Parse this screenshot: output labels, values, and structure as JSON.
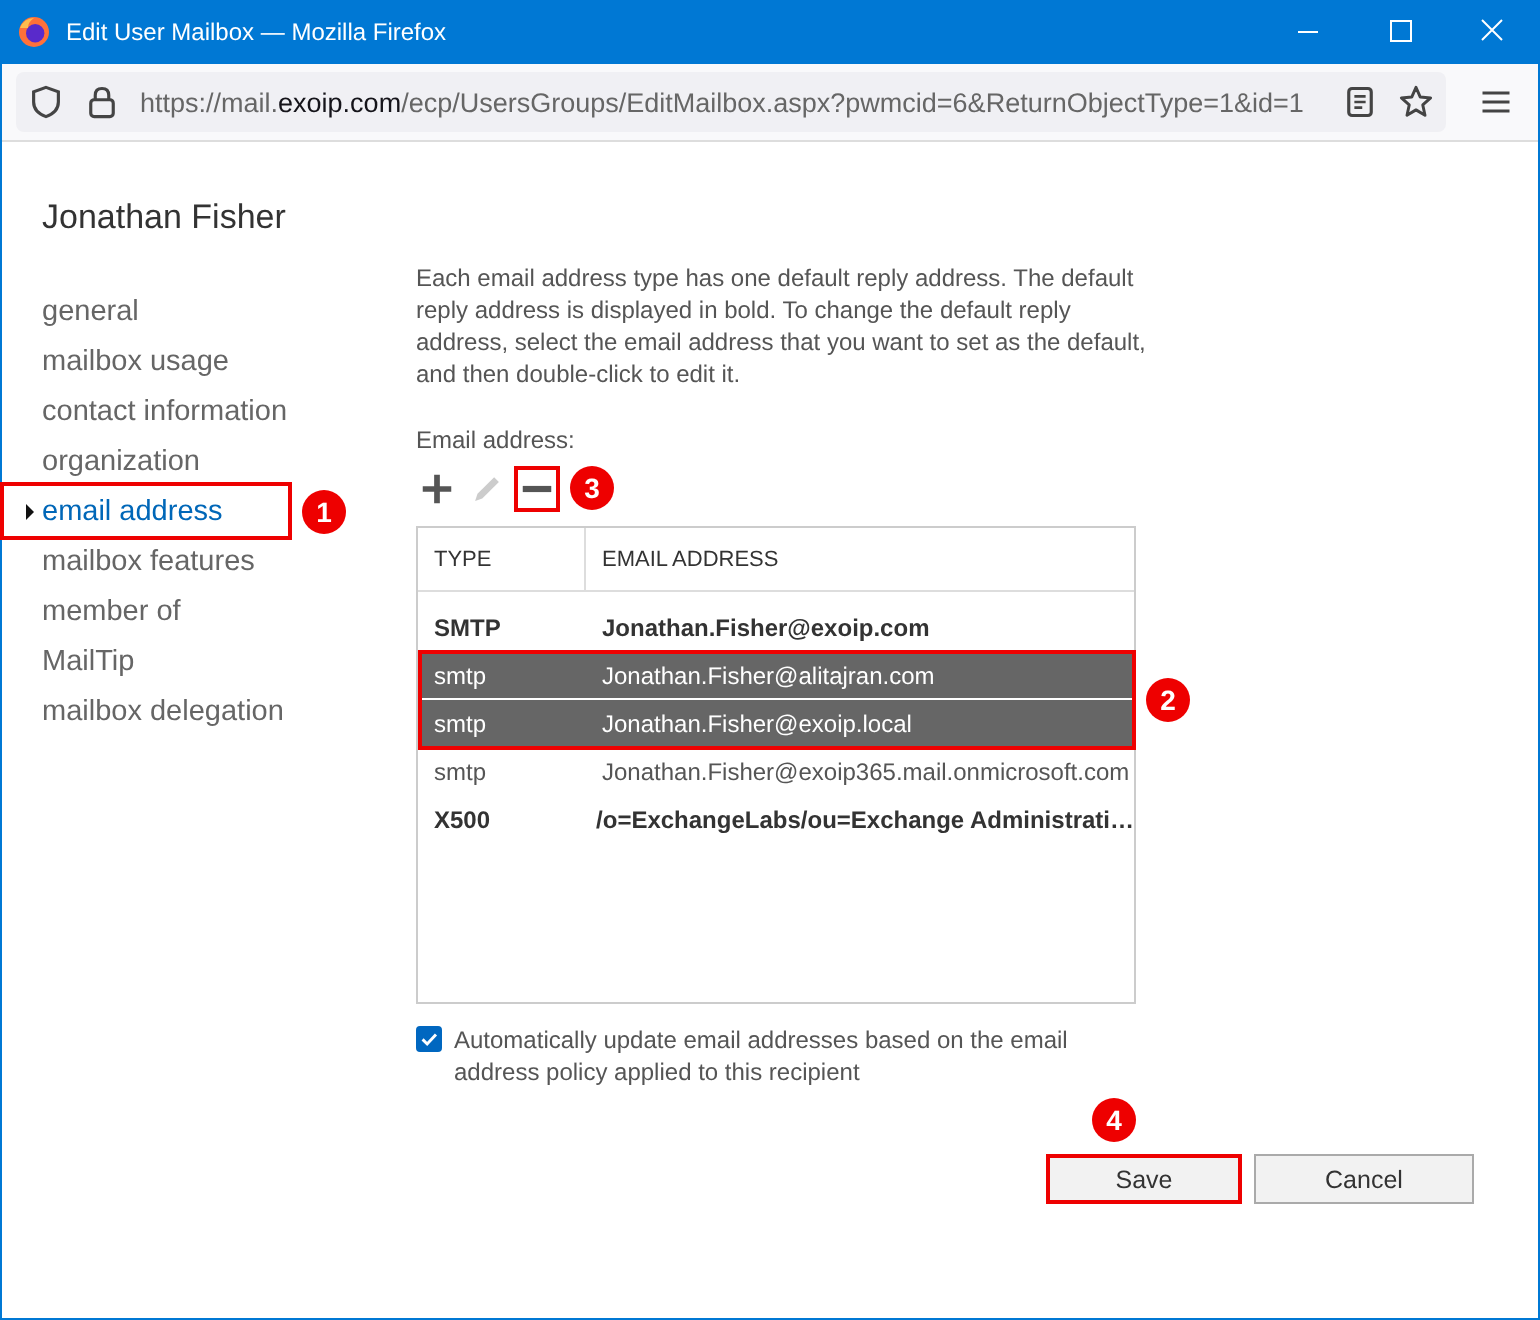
{
  "window": {
    "title": "Edit User Mailbox — Mozilla Firefox"
  },
  "address_bar": {
    "url_prefix": "https://mail.",
    "url_domain": "exoip.com",
    "url_path": "/ecp/UsersGroups/EditMailbox.aspx?pwmcid=6&ReturnObjectType=1&id=1"
  },
  "page_title": "Jonathan Fisher",
  "sidebar": {
    "items": [
      {
        "label": "general",
        "selected": false
      },
      {
        "label": "mailbox usage",
        "selected": false
      },
      {
        "label": "contact information",
        "selected": false
      },
      {
        "label": "organization",
        "selected": false
      },
      {
        "label": "email address",
        "selected": true,
        "callout": "1"
      },
      {
        "label": "mailbox features",
        "selected": false
      },
      {
        "label": "member of",
        "selected": false
      },
      {
        "label": "MailTip",
        "selected": false
      },
      {
        "label": "mailbox delegation",
        "selected": false
      }
    ]
  },
  "description": "Each email address type has one default reply address. The default reply address is displayed in bold. To change the default reply address, select the email address that you want to set as the default, and then double-click to edit it.",
  "list_label": "Email address:",
  "toolbar": [
    {
      "kind": "add",
      "disabled": false
    },
    {
      "kind": "edit",
      "disabled": true
    },
    {
      "kind": "remove",
      "disabled": false,
      "callout": "3"
    }
  ],
  "table": {
    "selection_callout": "2",
    "columns": [
      "TYPE",
      "EMAIL ADDRESS"
    ],
    "rows": [
      {
        "type": "SMTP",
        "address": "Jonathan.Fisher@exoip.com",
        "bold": true,
        "selected": false
      },
      {
        "type": "smtp",
        "address": "Jonathan.Fisher@alitajran.com",
        "bold": false,
        "selected": true
      },
      {
        "type": "smtp",
        "address": "Jonathan.Fisher@exoip.local",
        "bold": false,
        "selected": true
      },
      {
        "type": "smtp",
        "address": "Jonathan.Fisher@exoip365.mail.onmicrosoft.com",
        "bold": false,
        "selected": false
      },
      {
        "type": "X500",
        "address": "/o=ExchangeLabs/ou=Exchange Administrati…",
        "bold": true,
        "selected": false
      }
    ]
  },
  "auto_update": {
    "label": "Automatically update email addresses based on the email address policy applied to this recipient",
    "checked": true
  },
  "buttons": [
    {
      "kind": "save",
      "label": "Save",
      "callout": "4"
    },
    {
      "kind": "cancel",
      "label": "Cancel"
    }
  ]
}
